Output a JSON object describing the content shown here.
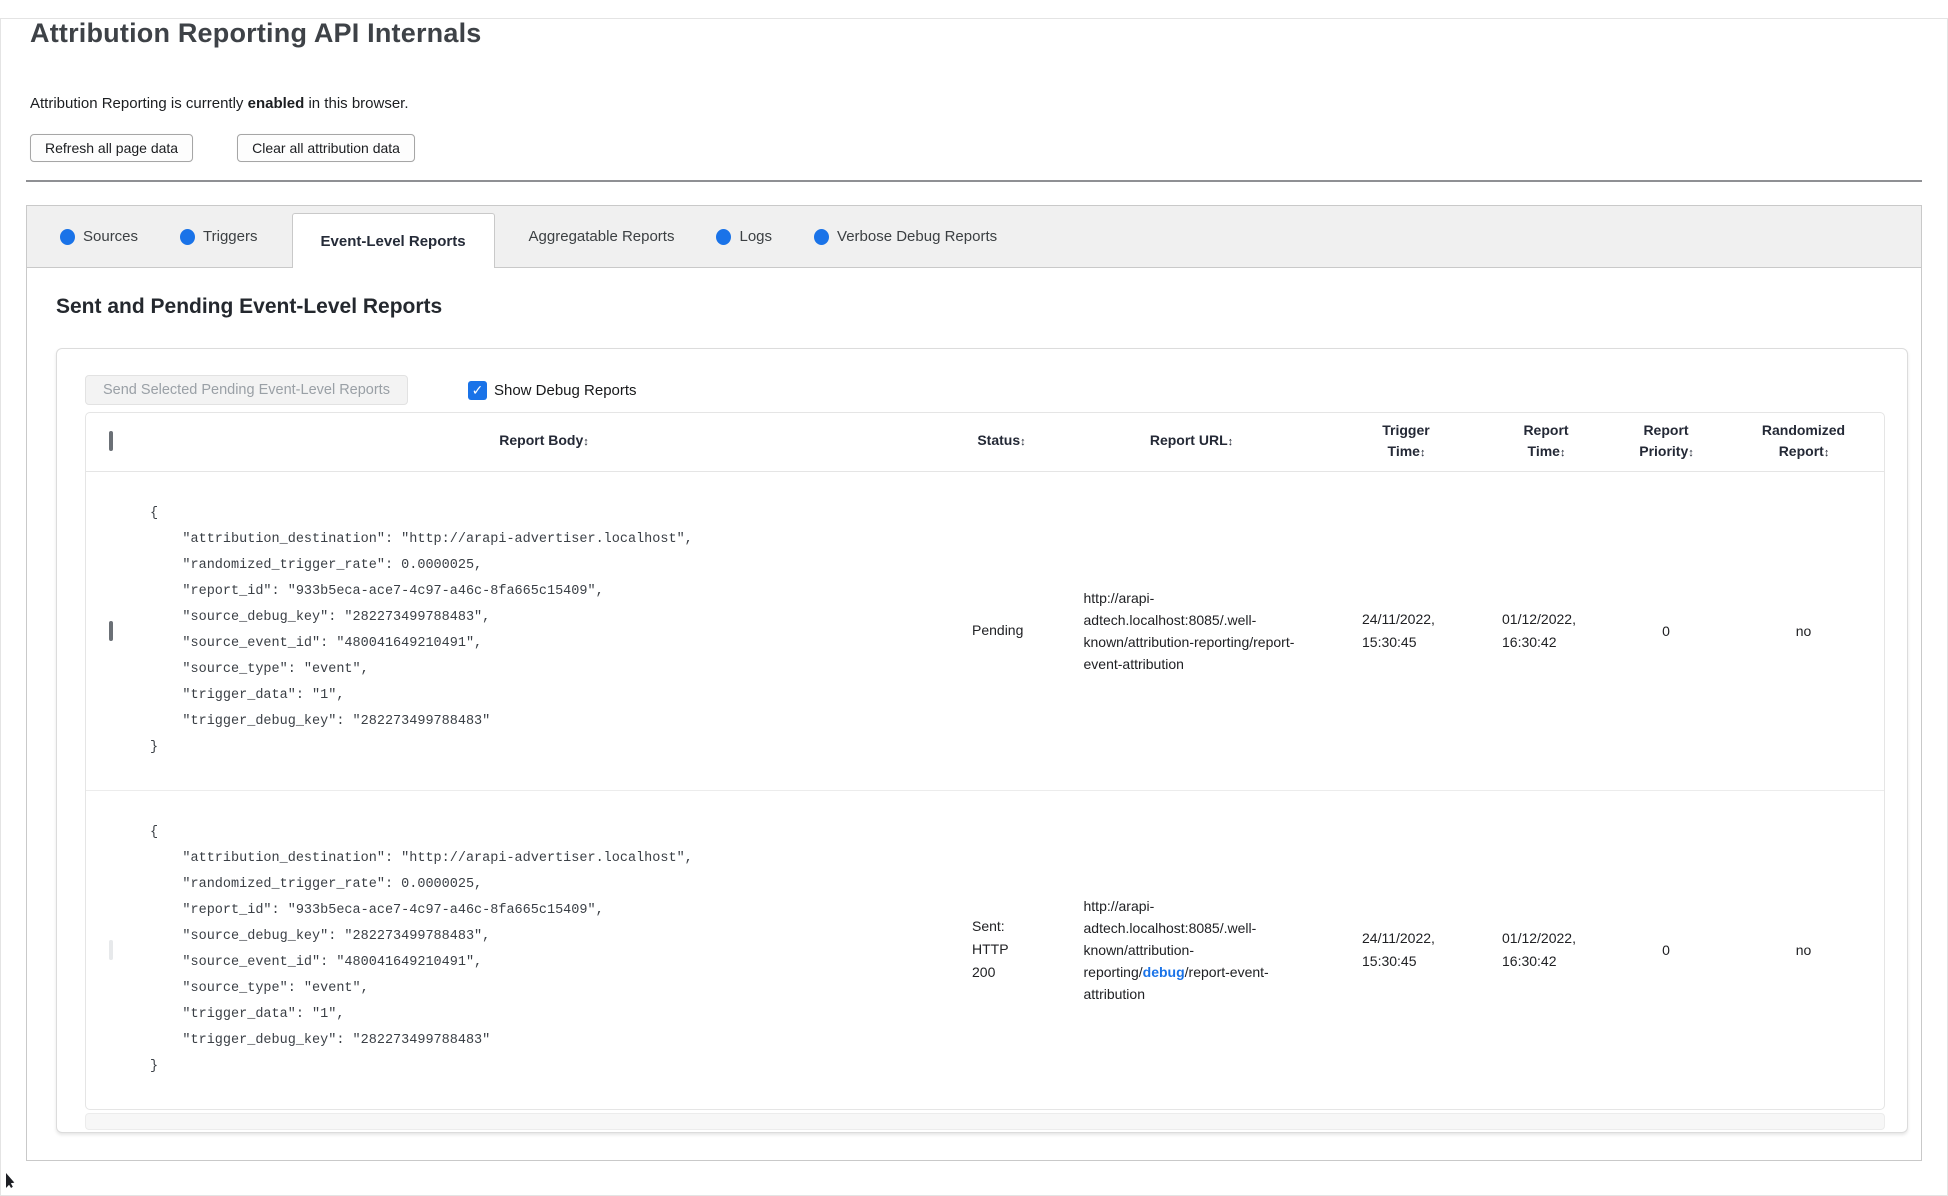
{
  "window": {
    "title": "Attribution Reporting API Internals"
  },
  "intro": {
    "text_before": "Attribution Reporting is currently ",
    "text_bold": "enabled",
    "text_after": " in this browser."
  },
  "actions": {
    "refresh_label": "Refresh all page data",
    "clear_label": "Clear all attribution data"
  },
  "tabs": {
    "items": [
      {
        "label": "Sources",
        "has_dot": true,
        "active": false
      },
      {
        "label": "Triggers",
        "has_dot": true,
        "active": false
      },
      {
        "label": "Event-Level Reports",
        "has_dot": false,
        "active": true
      },
      {
        "label": "Aggregatable Reports",
        "has_dot": false,
        "active": false
      },
      {
        "label": "Logs",
        "has_dot": true,
        "active": false
      },
      {
        "label": "Verbose Debug Reports",
        "has_dot": true,
        "active": false
      }
    ]
  },
  "panel": {
    "heading": "Sent and Pending Event-Level Reports",
    "send_button_label": "Send Selected Pending Event-Level Reports",
    "show_debug_label": "Show Debug Reports",
    "show_debug_checked": true
  },
  "icons": {
    "sort": "↕",
    "checkmark": "✓"
  },
  "colors": {
    "accent_blue": "#1a73e8"
  },
  "table": {
    "sort_icon": "↕",
    "headers": {
      "report_body": "Report Body",
      "status": "Status",
      "report_url": "Report URL",
      "trigger_time": "Trigger Time",
      "report_time": "Report Time",
      "report_priority": "Report Priority",
      "randomized_report": "Randomized Report"
    },
    "rows": [
      {
        "selectable": true,
        "report_body": "{\n    \"attribution_destination\": \"http://arapi-advertiser.localhost\",\n    \"randomized_trigger_rate\": 0.0000025,\n    \"report_id\": \"933b5eca-ace7-4c97-a46c-8fa665c15409\",\n    \"source_debug_key\": \"282273499788483\",\n    \"source_event_id\": \"480041649210491\",\n    \"source_type\": \"event\",\n    \"trigger_data\": \"1\",\n    \"trigger_debug_key\": \"282273499788483\"\n}",
        "status": "Pending",
        "report_url": "http://arapi-adtech.localhost:8085/.well-known/attribution-reporting/report-event-attribution",
        "trigger_time": "24/11/2022, 15:30:45",
        "report_time": "01/12/2022, 16:30:42",
        "report_priority": "0",
        "randomized_report": "no"
      },
      {
        "selectable": false,
        "report_body": "{\n    \"attribution_destination\": \"http://arapi-advertiser.localhost\",\n    \"randomized_trigger_rate\": 0.0000025,\n    \"report_id\": \"933b5eca-ace7-4c97-a46c-8fa665c15409\",\n    \"source_debug_key\": \"282273499788483\",\n    \"source_event_id\": \"480041649210491\",\n    \"source_type\": \"event\",\n    \"trigger_data\": \"1\",\n    \"trigger_debug_key\": \"282273499788483\"\n}",
        "status": "Sent: HTTP 200",
        "report_url_prefix": "http://arapi-adtech.localhost:8085/.well-known/attribution-reporting/",
        "report_url_debug_segment": "debug",
        "report_url_suffix": "/report-event-attribution",
        "trigger_time": "24/11/2022, 15:30:45",
        "report_time": "01/12/2022, 16:30:42",
        "report_priority": "0",
        "randomized_report": "no"
      }
    ]
  }
}
